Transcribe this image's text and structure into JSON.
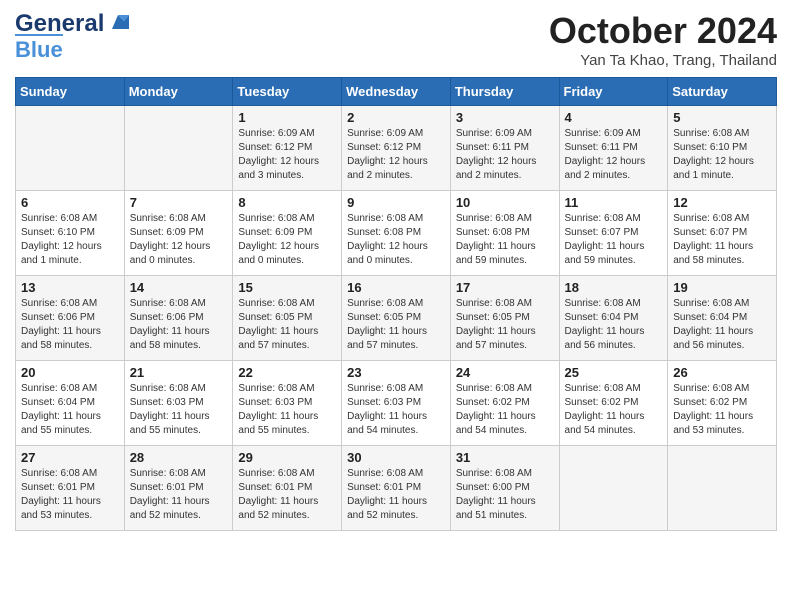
{
  "header": {
    "logo_line1": "General",
    "logo_line2": "Blue",
    "month": "October 2024",
    "location": "Yan Ta Khao, Trang, Thailand"
  },
  "days_of_week": [
    "Sunday",
    "Monday",
    "Tuesday",
    "Wednesday",
    "Thursday",
    "Friday",
    "Saturday"
  ],
  "weeks": [
    [
      {
        "day": "",
        "info": ""
      },
      {
        "day": "",
        "info": ""
      },
      {
        "day": "1",
        "info": "Sunrise: 6:09 AM\nSunset: 6:12 PM\nDaylight: 12 hours\nand 3 minutes."
      },
      {
        "day": "2",
        "info": "Sunrise: 6:09 AM\nSunset: 6:12 PM\nDaylight: 12 hours\nand 2 minutes."
      },
      {
        "day": "3",
        "info": "Sunrise: 6:09 AM\nSunset: 6:11 PM\nDaylight: 12 hours\nand 2 minutes."
      },
      {
        "day": "4",
        "info": "Sunrise: 6:09 AM\nSunset: 6:11 PM\nDaylight: 12 hours\nand 2 minutes."
      },
      {
        "day": "5",
        "info": "Sunrise: 6:08 AM\nSunset: 6:10 PM\nDaylight: 12 hours\nand 1 minute."
      }
    ],
    [
      {
        "day": "6",
        "info": "Sunrise: 6:08 AM\nSunset: 6:10 PM\nDaylight: 12 hours\nand 1 minute."
      },
      {
        "day": "7",
        "info": "Sunrise: 6:08 AM\nSunset: 6:09 PM\nDaylight: 12 hours\nand 0 minutes."
      },
      {
        "day": "8",
        "info": "Sunrise: 6:08 AM\nSunset: 6:09 PM\nDaylight: 12 hours\nand 0 minutes."
      },
      {
        "day": "9",
        "info": "Sunrise: 6:08 AM\nSunset: 6:08 PM\nDaylight: 12 hours\nand 0 minutes."
      },
      {
        "day": "10",
        "info": "Sunrise: 6:08 AM\nSunset: 6:08 PM\nDaylight: 11 hours\nand 59 minutes."
      },
      {
        "day": "11",
        "info": "Sunrise: 6:08 AM\nSunset: 6:07 PM\nDaylight: 11 hours\nand 59 minutes."
      },
      {
        "day": "12",
        "info": "Sunrise: 6:08 AM\nSunset: 6:07 PM\nDaylight: 11 hours\nand 58 minutes."
      }
    ],
    [
      {
        "day": "13",
        "info": "Sunrise: 6:08 AM\nSunset: 6:06 PM\nDaylight: 11 hours\nand 58 minutes."
      },
      {
        "day": "14",
        "info": "Sunrise: 6:08 AM\nSunset: 6:06 PM\nDaylight: 11 hours\nand 58 minutes."
      },
      {
        "day": "15",
        "info": "Sunrise: 6:08 AM\nSunset: 6:05 PM\nDaylight: 11 hours\nand 57 minutes."
      },
      {
        "day": "16",
        "info": "Sunrise: 6:08 AM\nSunset: 6:05 PM\nDaylight: 11 hours\nand 57 minutes."
      },
      {
        "day": "17",
        "info": "Sunrise: 6:08 AM\nSunset: 6:05 PM\nDaylight: 11 hours\nand 57 minutes."
      },
      {
        "day": "18",
        "info": "Sunrise: 6:08 AM\nSunset: 6:04 PM\nDaylight: 11 hours\nand 56 minutes."
      },
      {
        "day": "19",
        "info": "Sunrise: 6:08 AM\nSunset: 6:04 PM\nDaylight: 11 hours\nand 56 minutes."
      }
    ],
    [
      {
        "day": "20",
        "info": "Sunrise: 6:08 AM\nSunset: 6:04 PM\nDaylight: 11 hours\nand 55 minutes."
      },
      {
        "day": "21",
        "info": "Sunrise: 6:08 AM\nSunset: 6:03 PM\nDaylight: 11 hours\nand 55 minutes."
      },
      {
        "day": "22",
        "info": "Sunrise: 6:08 AM\nSunset: 6:03 PM\nDaylight: 11 hours\nand 55 minutes."
      },
      {
        "day": "23",
        "info": "Sunrise: 6:08 AM\nSunset: 6:03 PM\nDaylight: 11 hours\nand 54 minutes."
      },
      {
        "day": "24",
        "info": "Sunrise: 6:08 AM\nSunset: 6:02 PM\nDaylight: 11 hours\nand 54 minutes."
      },
      {
        "day": "25",
        "info": "Sunrise: 6:08 AM\nSunset: 6:02 PM\nDaylight: 11 hours\nand 54 minutes."
      },
      {
        "day": "26",
        "info": "Sunrise: 6:08 AM\nSunset: 6:02 PM\nDaylight: 11 hours\nand 53 minutes."
      }
    ],
    [
      {
        "day": "27",
        "info": "Sunrise: 6:08 AM\nSunset: 6:01 PM\nDaylight: 11 hours\nand 53 minutes."
      },
      {
        "day": "28",
        "info": "Sunrise: 6:08 AM\nSunset: 6:01 PM\nDaylight: 11 hours\nand 52 minutes."
      },
      {
        "day": "29",
        "info": "Sunrise: 6:08 AM\nSunset: 6:01 PM\nDaylight: 11 hours\nand 52 minutes."
      },
      {
        "day": "30",
        "info": "Sunrise: 6:08 AM\nSunset: 6:01 PM\nDaylight: 11 hours\nand 52 minutes."
      },
      {
        "day": "31",
        "info": "Sunrise: 6:08 AM\nSunset: 6:00 PM\nDaylight: 11 hours\nand 51 minutes."
      },
      {
        "day": "",
        "info": ""
      },
      {
        "day": "",
        "info": ""
      }
    ]
  ]
}
